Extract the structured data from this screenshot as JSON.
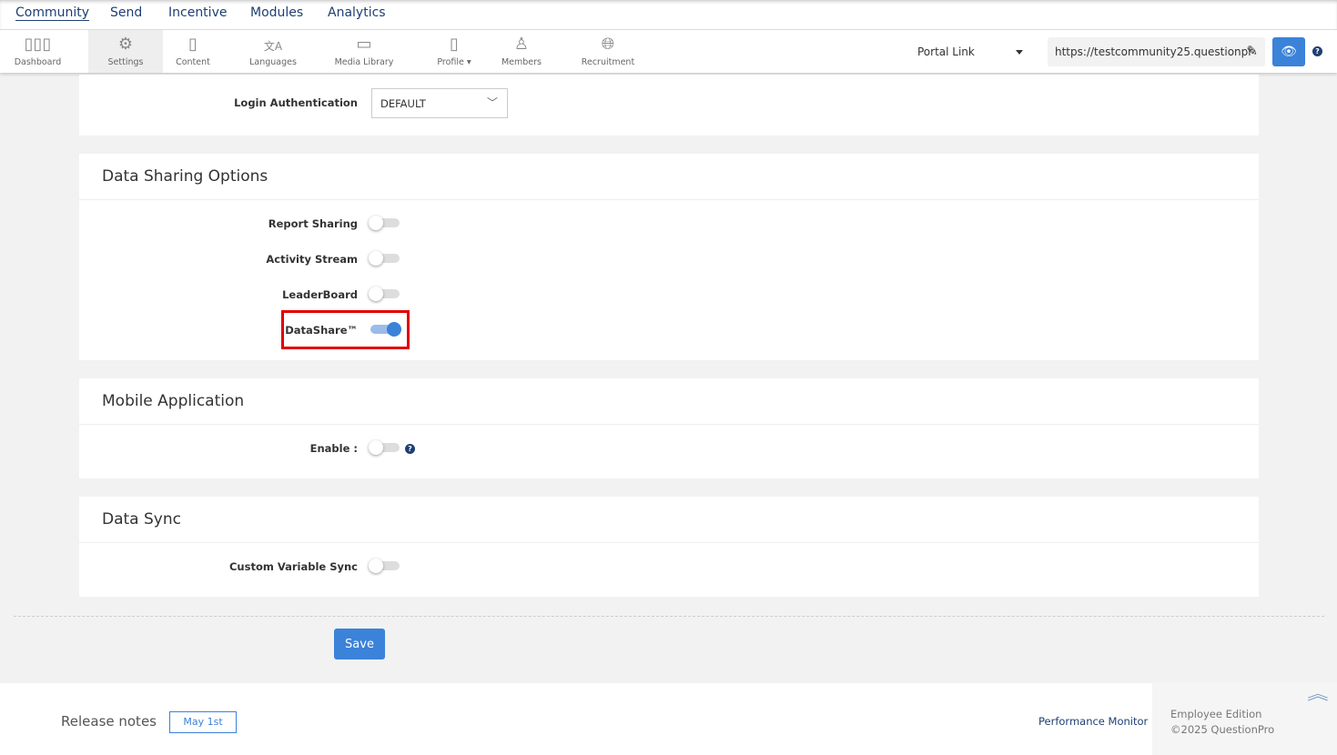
{
  "topnav": {
    "items": [
      "Community",
      "Send",
      "Incentive",
      "Modules",
      "Analytics"
    ]
  },
  "toolbar": {
    "items": [
      {
        "label": "Dashboard",
        "icon": "bar-chart-icon"
      },
      {
        "label": "Settings",
        "icon": "gear-icon"
      },
      {
        "label": "Content",
        "icon": "document-icon"
      },
      {
        "label": "Languages",
        "icon": "translate-icon"
      },
      {
        "label": "Media Library",
        "icon": "image-icon"
      },
      {
        "label": "Profile",
        "icon": "profile-icon"
      },
      {
        "label": "Members",
        "icon": "member-icon"
      },
      {
        "label": "Recruitment",
        "icon": "globe-icon"
      }
    ],
    "portal_label": "Portal Link",
    "portal_url": "https://testcommunity25.questionpr"
  },
  "login": {
    "label": "Login Authentication",
    "value": "DEFAULT"
  },
  "data_sharing": {
    "title": "Data Sharing Options",
    "items": [
      {
        "label": "Report Sharing",
        "on": false
      },
      {
        "label": "Activity Stream",
        "on": false
      },
      {
        "label": "LeaderBoard",
        "on": false
      },
      {
        "label": "DataShare™",
        "on": true
      }
    ]
  },
  "mobile": {
    "title": "Mobile Application",
    "label": "Enable :",
    "on": false
  },
  "data_sync": {
    "title": "Data Sync",
    "label": "Custom Variable Sync",
    "on": false
  },
  "save_label": "Save",
  "footer": {
    "release_notes": "Release notes",
    "release_date": "May 1st",
    "performance": "Performance Monitor",
    "edition": "Employee Edition",
    "copyright": "©2025 QuestionPro"
  },
  "colors": {
    "accent": "#3b82d9",
    "nav": "#1e3f73",
    "highlight": "#e00000"
  }
}
